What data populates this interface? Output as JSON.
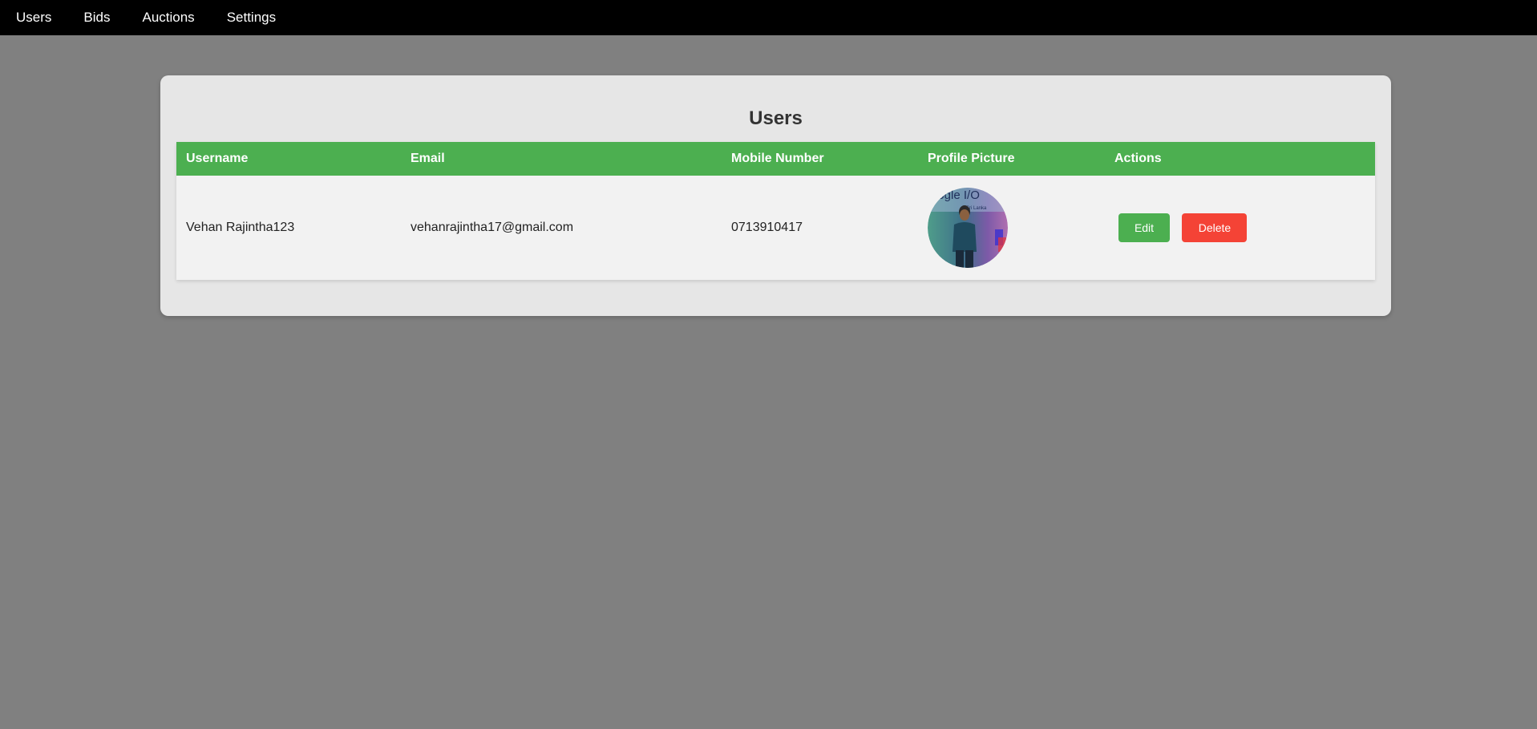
{
  "nav": {
    "items": [
      {
        "label": "Users"
      },
      {
        "label": "Bids"
      },
      {
        "label": "Auctions"
      },
      {
        "label": "Settings"
      }
    ]
  },
  "panel": {
    "title": "Users"
  },
  "table": {
    "columns": [
      "Username",
      "Email",
      "Mobile Number",
      "Profile Picture",
      "Actions"
    ],
    "rows": [
      {
        "username": "Vehan Rajintha123",
        "email": "vehanrajintha17@gmail.com",
        "mobile": "0713910417",
        "avatar_overlay_text": "oogle I/O",
        "avatar_overlay_subtext": "Sri Lanka",
        "edit_label": "Edit",
        "delete_label": "Delete"
      }
    ]
  },
  "colors": {
    "nav_bg": "#000000",
    "page_bg": "#808080",
    "panel_bg": "#e6e6e6",
    "header_green": "#4caf50",
    "delete_red": "#f44336"
  }
}
